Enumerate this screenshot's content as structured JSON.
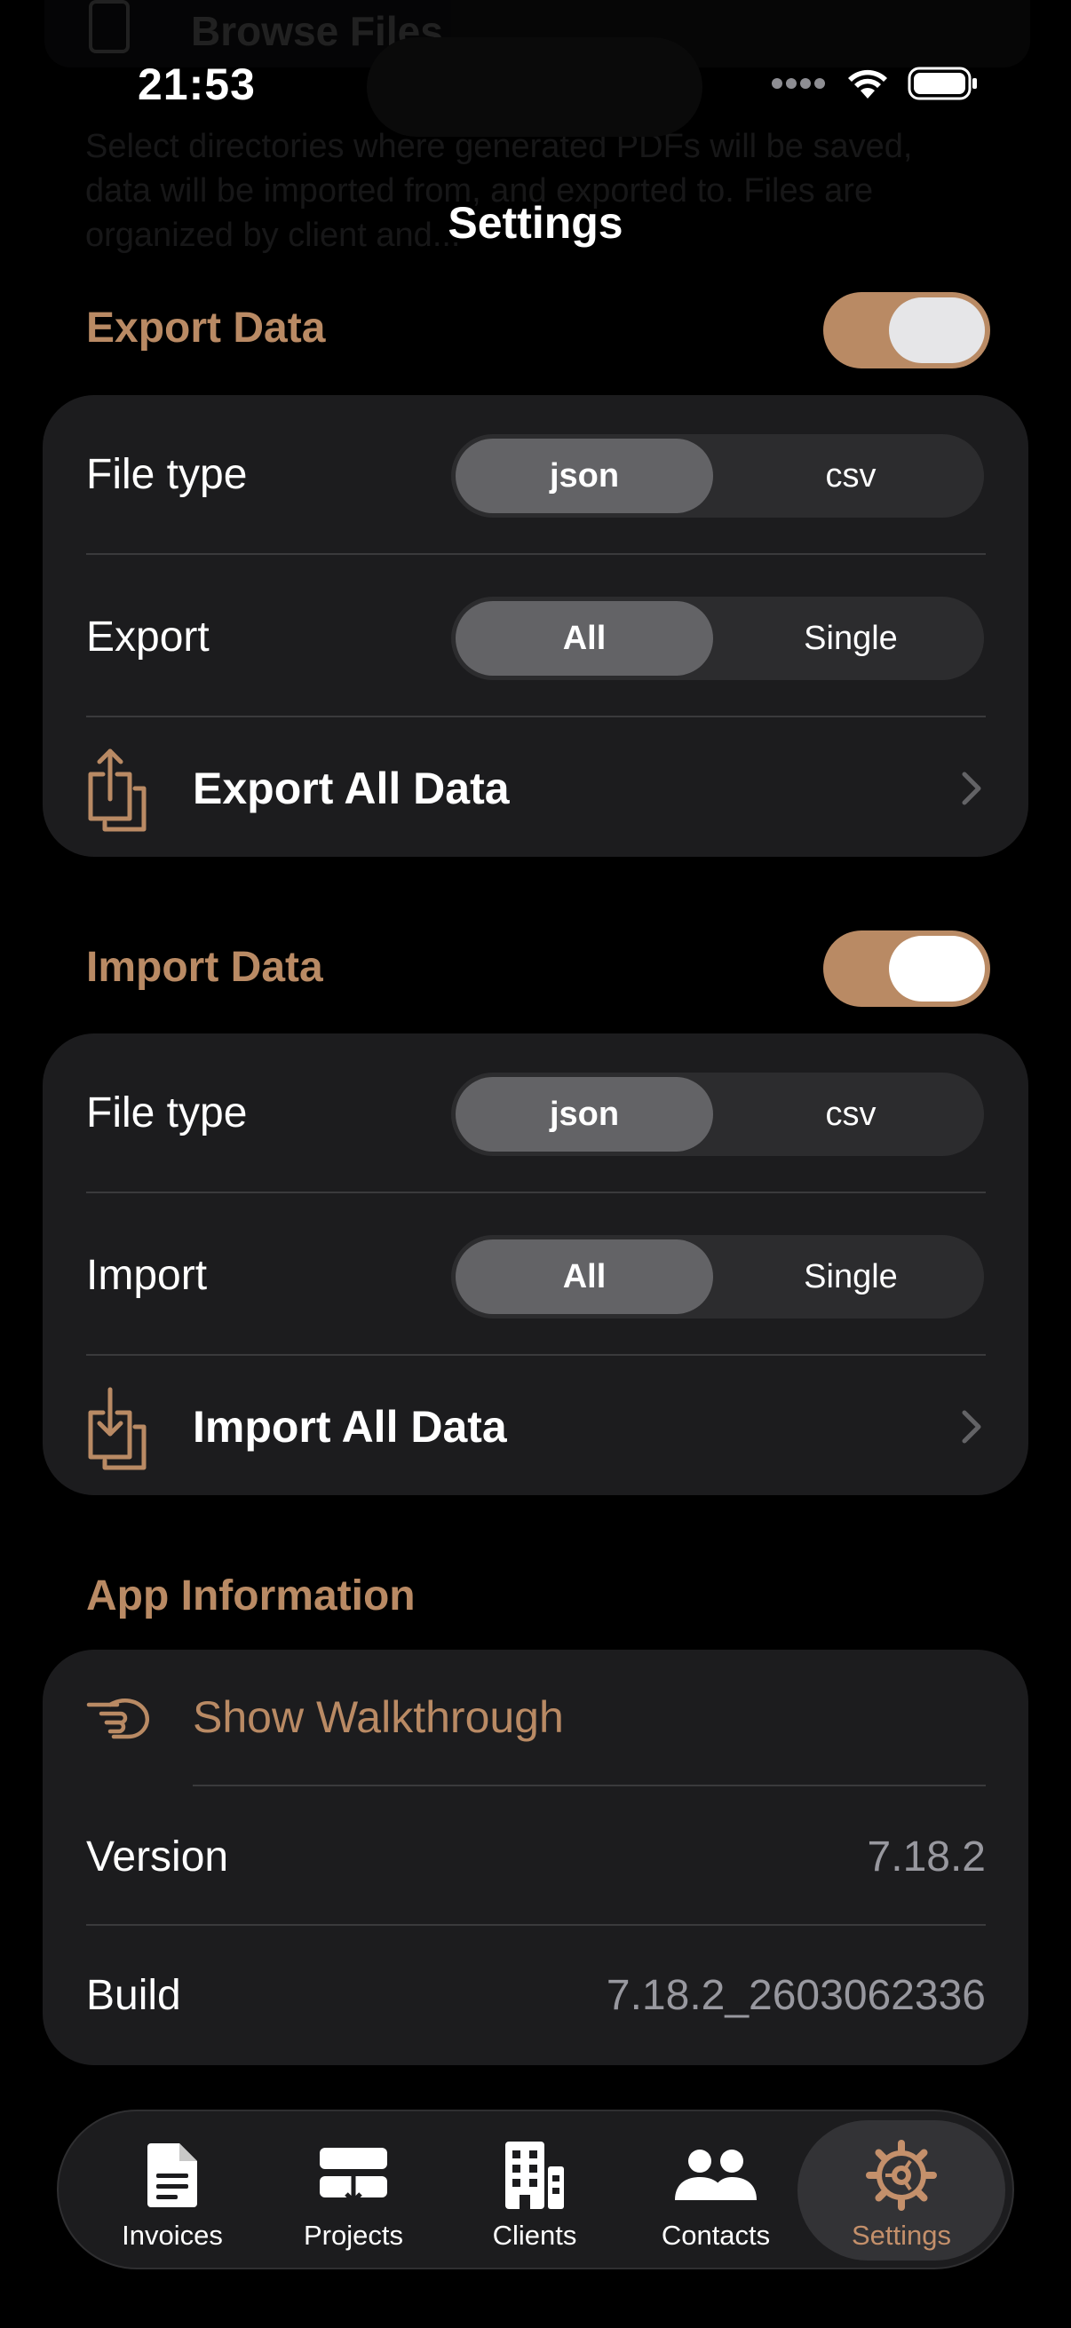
{
  "background": {
    "title": "Browse Files",
    "description": "Select directories where generated PDFs will be saved, data will be imported from, and exported to. Files are organized by client and..."
  },
  "status_bar": {
    "time": "21:53"
  },
  "nav": {
    "title": "Settings"
  },
  "colors": {
    "accent": "#b98a64",
    "card": "#1c1c1e",
    "background": "#000000"
  },
  "export": {
    "title": "Export Data",
    "toggle_on": true,
    "file_type": {
      "label": "File type",
      "options": [
        "json",
        "csv"
      ],
      "selected": "json"
    },
    "scope": {
      "label": "Export",
      "options": [
        "All",
        "Single"
      ],
      "selected": "All"
    },
    "action": {
      "label": "Export All Data",
      "icon": "share-export-icon"
    }
  },
  "import": {
    "title": "Import Data",
    "toggle_on": true,
    "file_type": {
      "label": "File type",
      "options": [
        "json",
        "csv"
      ],
      "selected": "json"
    },
    "scope": {
      "label": "Import",
      "options": [
        "All",
        "Single"
      ],
      "selected": "All"
    },
    "action": {
      "label": "Import All Data",
      "icon": "import-tray-icon"
    }
  },
  "app_info": {
    "title": "App Information",
    "walkthrough": {
      "label": "Show Walkthrough",
      "icon": "pointing-hand-icon"
    },
    "version": {
      "label": "Version",
      "value": "7.18.2"
    },
    "build": {
      "label": "Build",
      "value": "7.18.2_2603062336"
    }
  },
  "tabbar": {
    "tabs": [
      {
        "label": "Invoices",
        "icon": "document-icon"
      },
      {
        "label": "Projects",
        "icon": "projects-icon"
      },
      {
        "label": "Clients",
        "icon": "building-icon"
      },
      {
        "label": "Contacts",
        "icon": "people-icon"
      },
      {
        "label": "Settings",
        "icon": "gear-icon"
      }
    ],
    "active": "Settings"
  }
}
